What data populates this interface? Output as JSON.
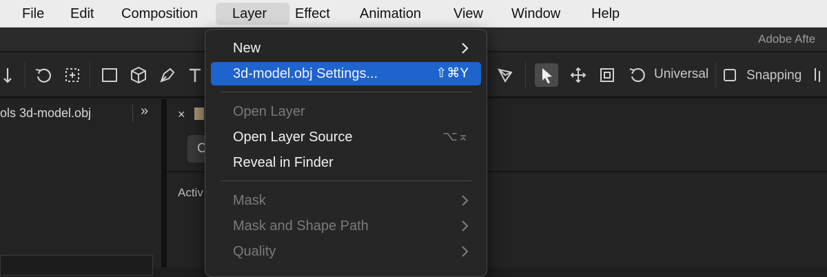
{
  "menubar": {
    "items": [
      "File",
      "Edit",
      "Composition",
      "Layer",
      "Effect",
      "Animation",
      "View",
      "Window",
      "Help"
    ],
    "active": "Layer"
  },
  "app": {
    "title": "Adobe Afte"
  },
  "toolbar": {
    "universal_label": "Universal",
    "snapping_label": "Snapping"
  },
  "left_panel": {
    "tab_label": "ols 3d-model.obj"
  },
  "main_panel": {
    "tab_close": "×",
    "comp_button_label": "C",
    "active_label": "Activ"
  },
  "layer_menu": {
    "items": [
      {
        "label": "New",
        "submenu": true,
        "disabled": false
      },
      {
        "label": "3d-model.obj Settings...",
        "shortcut": "⇧⌘Y",
        "highlighted": true,
        "disabled": false
      },
      {
        "label": "Open Layer",
        "disabled": true
      },
      {
        "label": "Open Layer Source",
        "shortcut": "⌥⌅",
        "shortcut_dim": true,
        "disabled": false
      },
      {
        "label": "Reveal in Finder",
        "disabled": false
      },
      {
        "label": "Mask",
        "submenu": true,
        "disabled": true
      },
      {
        "label": "Mask and Shape Path",
        "submenu": true,
        "disabled": true
      },
      {
        "label": "Quality",
        "submenu": true,
        "disabled": true
      }
    ]
  },
  "colors": {
    "highlight": "#1f63cc",
    "menubar_bg": "#ececec",
    "app_bg": "#1e1e1e",
    "disabled_text": "#7a7a7a"
  }
}
